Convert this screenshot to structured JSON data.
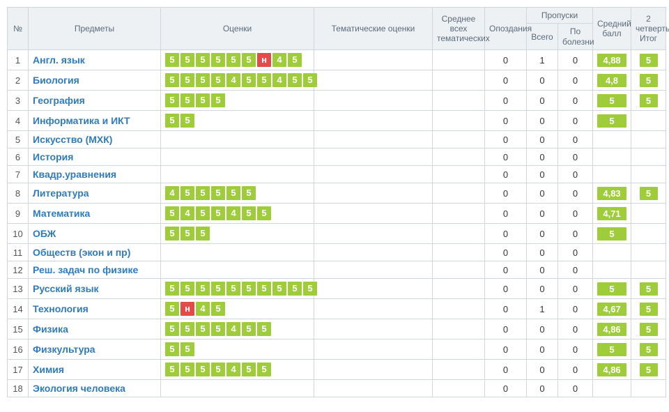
{
  "headers": {
    "num": "№",
    "subject": "Предметы",
    "grades": "Оценки",
    "thematic": "Тематические оценки",
    "avg_thematic": "Среднее всех тематических",
    "late": "Опоздания",
    "absences": "Пропуски",
    "abs_total": "Всего",
    "abs_ill": "По болезни",
    "avg": "Средний балл",
    "quarter": "2 четверть Итог"
  },
  "rows": [
    {
      "n": 1,
      "subject": "Англ. язык",
      "grades": [
        "5",
        "5",
        "5",
        "5",
        "5",
        "5",
        "н",
        "4",
        "5"
      ],
      "late": "0",
      "abs_t": "1",
      "abs_i": "0",
      "avg": "4,88",
      "q": "5"
    },
    {
      "n": 2,
      "subject": "Биология",
      "grades": [
        "5",
        "5",
        "5",
        "5",
        "4",
        "5",
        "5",
        "4",
        "5",
        "5"
      ],
      "late": "0",
      "abs_t": "0",
      "abs_i": "0",
      "avg": "4,8",
      "q": "5"
    },
    {
      "n": 3,
      "subject": "География",
      "grades": [
        "5",
        "5",
        "5",
        "5"
      ],
      "late": "0",
      "abs_t": "0",
      "abs_i": "0",
      "avg": "5",
      "q": "5"
    },
    {
      "n": 4,
      "subject": "Информатика и ИКТ",
      "grades": [
        "5",
        "5"
      ],
      "late": "0",
      "abs_t": "0",
      "abs_i": "0",
      "avg": "5",
      "q": ""
    },
    {
      "n": 5,
      "subject": "Искусство (МХК)",
      "grades": [],
      "late": "0",
      "abs_t": "0",
      "abs_i": "0",
      "avg": "",
      "q": ""
    },
    {
      "n": 6,
      "subject": "История",
      "grades": [],
      "late": "0",
      "abs_t": "0",
      "abs_i": "0",
      "avg": "",
      "q": ""
    },
    {
      "n": 7,
      "subject": "Квадр.уравнения",
      "grades": [],
      "late": "0",
      "abs_t": "0",
      "abs_i": "0",
      "avg": "",
      "q": ""
    },
    {
      "n": 8,
      "subject": "Литература",
      "grades": [
        "4",
        "5",
        "5",
        "5",
        "5",
        "5"
      ],
      "late": "0",
      "abs_t": "0",
      "abs_i": "0",
      "avg": "4,83",
      "q": "5"
    },
    {
      "n": 9,
      "subject": "Математика",
      "grades": [
        "5",
        "4",
        "5",
        "5",
        "4",
        "5",
        "5"
      ],
      "late": "0",
      "abs_t": "0",
      "abs_i": "0",
      "avg": "4,71",
      "q": ""
    },
    {
      "n": 10,
      "subject": "ОБЖ",
      "grades": [
        "5",
        "5",
        "5"
      ],
      "late": "0",
      "abs_t": "0",
      "abs_i": "0",
      "avg": "5",
      "q": ""
    },
    {
      "n": 11,
      "subject": "Обществ (экон и пр)",
      "grades": [],
      "late": "0",
      "abs_t": "0",
      "abs_i": "0",
      "avg": "",
      "q": ""
    },
    {
      "n": 12,
      "subject": "Реш. задач по физике",
      "grades": [],
      "late": "0",
      "abs_t": "0",
      "abs_i": "0",
      "avg": "",
      "q": ""
    },
    {
      "n": 13,
      "subject": "Русский язык",
      "grades": [
        "5",
        "5",
        "5",
        "5",
        "5",
        "5",
        "5",
        "5",
        "5",
        "5"
      ],
      "late": "0",
      "abs_t": "0",
      "abs_i": "0",
      "avg": "5",
      "q": "5"
    },
    {
      "n": 14,
      "subject": "Технология",
      "grades": [
        "5",
        "н",
        "4",
        "5"
      ],
      "late": "0",
      "abs_t": "1",
      "abs_i": "0",
      "avg": "4,67",
      "q": "5"
    },
    {
      "n": 15,
      "subject": "Физика",
      "grades": [
        "5",
        "5",
        "5",
        "5",
        "4",
        "5",
        "5"
      ],
      "late": "0",
      "abs_t": "0",
      "abs_i": "0",
      "avg": "4,86",
      "q": "5"
    },
    {
      "n": 16,
      "subject": "Физкультура",
      "grades": [
        "5",
        "5"
      ],
      "late": "0",
      "abs_t": "0",
      "abs_i": "0",
      "avg": "5",
      "q": "5"
    },
    {
      "n": 17,
      "subject": "Химия",
      "grades": [
        "5",
        "5",
        "5",
        "5",
        "4",
        "5",
        "5"
      ],
      "late": "0",
      "abs_t": "0",
      "abs_i": "0",
      "avg": "4,86",
      "q": "5"
    },
    {
      "n": 18,
      "subject": "Экология человека",
      "grades": [],
      "late": "0",
      "abs_t": "0",
      "abs_i": "0",
      "avg": "",
      "q": ""
    }
  ]
}
